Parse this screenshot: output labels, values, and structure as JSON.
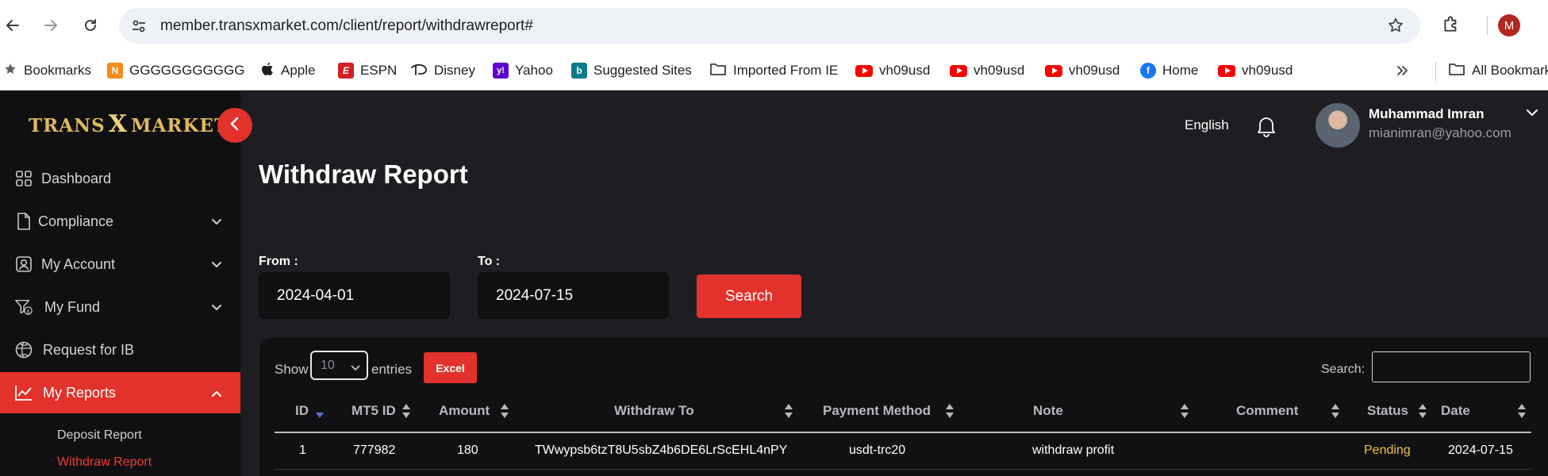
{
  "browser": {
    "url": "member.transxmarket.com/client/report/withdrawreport#",
    "profile_initial": "M",
    "bookmarks": [
      {
        "label": "Bookmarks",
        "icon": "star-icon"
      },
      {
        "label": "GGGGGGGGGGG",
        "icon": "n-square-icon"
      },
      {
        "label": "Apple",
        "icon": "apple-icon"
      },
      {
        "label": "ESPN",
        "icon": "espn-icon"
      },
      {
        "label": "Disney",
        "icon": "disney-icon"
      },
      {
        "label": "Yahoo",
        "icon": "yahoo-icon"
      },
      {
        "label": "Suggested Sites",
        "icon": "bing-icon"
      },
      {
        "label": "Imported From IE",
        "icon": "folder-icon"
      },
      {
        "label": "vh09usd",
        "icon": "youtube-icon"
      },
      {
        "label": "vh09usd",
        "icon": "youtube-icon"
      },
      {
        "label": "vh09usd",
        "icon": "youtube-icon"
      },
      {
        "label": "Home",
        "icon": "facebook-icon"
      },
      {
        "label": "vh09usd",
        "icon": "youtube-icon"
      }
    ],
    "all_bookmarks": "All Bookmarks"
  },
  "app": {
    "logo_left": "TRANS",
    "logo_x": "X",
    "logo_right": "MARKETS",
    "language": "English",
    "user_name": "Muhammad Imran",
    "user_email": "mianimran@yahoo.com",
    "accent_color": "#e2322b"
  },
  "sidebar": {
    "items": [
      {
        "label": "Dashboard",
        "icon": "dashboard-grid-icon"
      },
      {
        "label": "Compliance",
        "icon": "document-icon"
      },
      {
        "label": "My Account",
        "icon": "user-icon"
      },
      {
        "label": "My Fund",
        "icon": "fund-icon"
      },
      {
        "label": "Request for IB",
        "icon": "ib-icon"
      },
      {
        "label": "My Reports",
        "icon": "chart-line-icon"
      }
    ],
    "sub_items": [
      "Deposit Report",
      "Withdraw Report"
    ]
  },
  "page": {
    "title": "Withdraw Report",
    "from_label": "From :",
    "from_value": "2024-04-01",
    "to_label": "To :",
    "to_value": "2024-07-15",
    "search_button": "Search"
  },
  "table": {
    "show_label": "Show",
    "entries_value": "10",
    "entries_label": "entries",
    "excel_label": "Excel",
    "search_label": "Search:",
    "columns": [
      "ID",
      "MT5 ID",
      "Amount",
      "Withdraw To",
      "Payment Method",
      "Note",
      "Comment",
      "Status",
      "Date"
    ],
    "rows": [
      [
        "1",
        "777982",
        "180",
        "TWwypsb6tzT8U5sbZ4b6DE6LrScEHL4nPY",
        "usdt-trc20",
        "withdraw profit",
        "",
        "Pending",
        "2024-07-15"
      ]
    ]
  }
}
